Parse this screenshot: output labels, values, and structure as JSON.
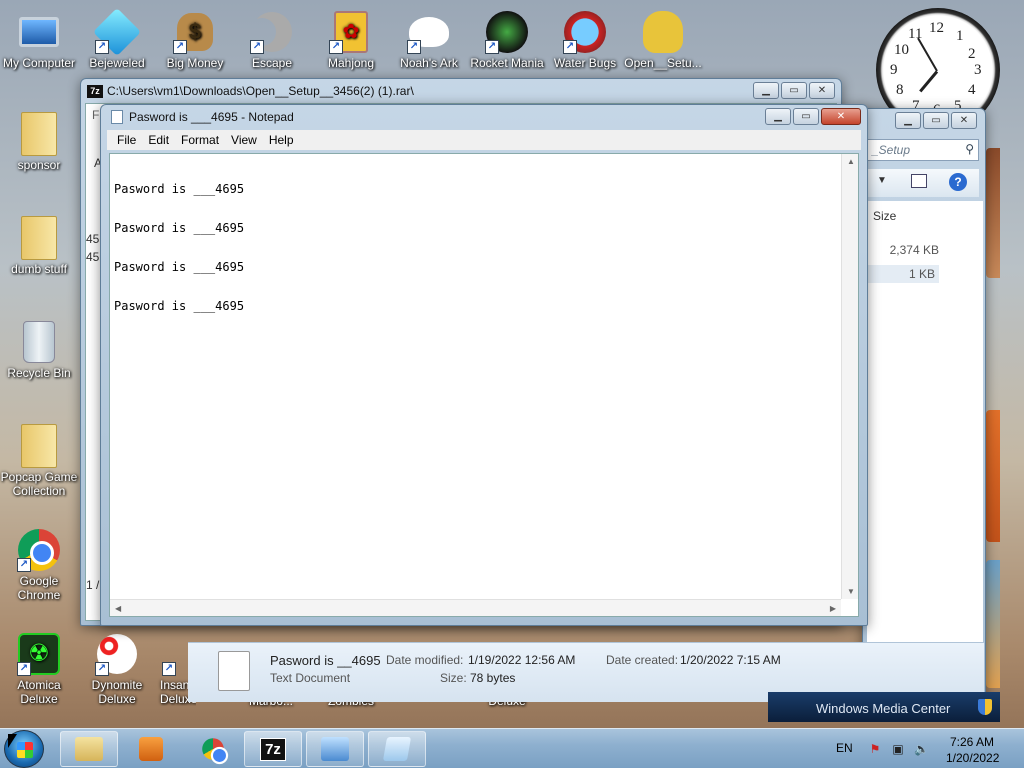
{
  "desktop": {
    "icons": [
      {
        "label": "My Computer"
      },
      {
        "label": "Bejeweled"
      },
      {
        "label": "Big Money"
      },
      {
        "label": "Escape"
      },
      {
        "label": "Mahjong"
      },
      {
        "label": "Noah's Ark"
      },
      {
        "label": "Rocket Mania"
      },
      {
        "label": "Water Bugs"
      },
      {
        "label": "Open__Setu..."
      },
      {
        "label": "sponsor"
      },
      {
        "label": "dumb stuff"
      },
      {
        "label": "Recycle Bin"
      },
      {
        "label": "Popcap Game Collection"
      },
      {
        "label": "Google Chrome"
      },
      {
        "label": "Atomica Deluxe"
      },
      {
        "label": "Dynomite Deluxe"
      },
      {
        "label": "Insan... Deluxe"
      },
      {
        "label": "Marbo..."
      },
      {
        "label": "Zombies"
      },
      {
        "label": "Deluxe"
      }
    ]
  },
  "clock": {
    "numbers": [
      "12",
      "1",
      "2",
      "3",
      "4",
      "5",
      "6",
      "7",
      "8",
      "9",
      "10",
      "11"
    ],
    "time": "7:26"
  },
  "zip_window": {
    "title": "C:\\Users\\vm1\\Downloads\\Open__Setup__3456(2) (1).rar\\",
    "menu_fragment": "Fi",
    "left_fragment_a": "A",
    "row1_fragment": "456",
    "row2_fragment": "456",
    "status_fragment": "1 /"
  },
  "explorer_window": {
    "search_placeholder": "_Setup",
    "column_size": "Size",
    "rows": [
      {
        "size": "2,374 KB"
      },
      {
        "size": "1 KB"
      }
    ]
  },
  "notepad": {
    "title": "Pasword is ___4695 - Notepad",
    "menu": [
      "File",
      "Edit",
      "Format",
      "View",
      "Help"
    ],
    "lines": [
      "Pasword is ___4695",
      "Pasword is ___4695",
      "Pasword is ___4695",
      "Pasword is ___4695"
    ]
  },
  "details_pane": {
    "file_name": "Pasword is __4695",
    "file_type": "Text Document",
    "date_modified_label": "Date modified:",
    "date_modified": "1/19/2022 12:56 AM",
    "date_created_label": "Date created:",
    "date_created": "1/20/2022 7:15 AM",
    "size_label": "Size:",
    "size": "78 bytes"
  },
  "media_center": {
    "label": "Windows Media Center"
  },
  "taskbar": {
    "language": "EN",
    "time": "7:26 AM",
    "date": "1/20/2022",
    "zip_label": "7z"
  },
  "colors": {
    "taskbar": "#8eb0cf",
    "window_frame": "#a8bfd4",
    "close_button": "#c4442c"
  }
}
